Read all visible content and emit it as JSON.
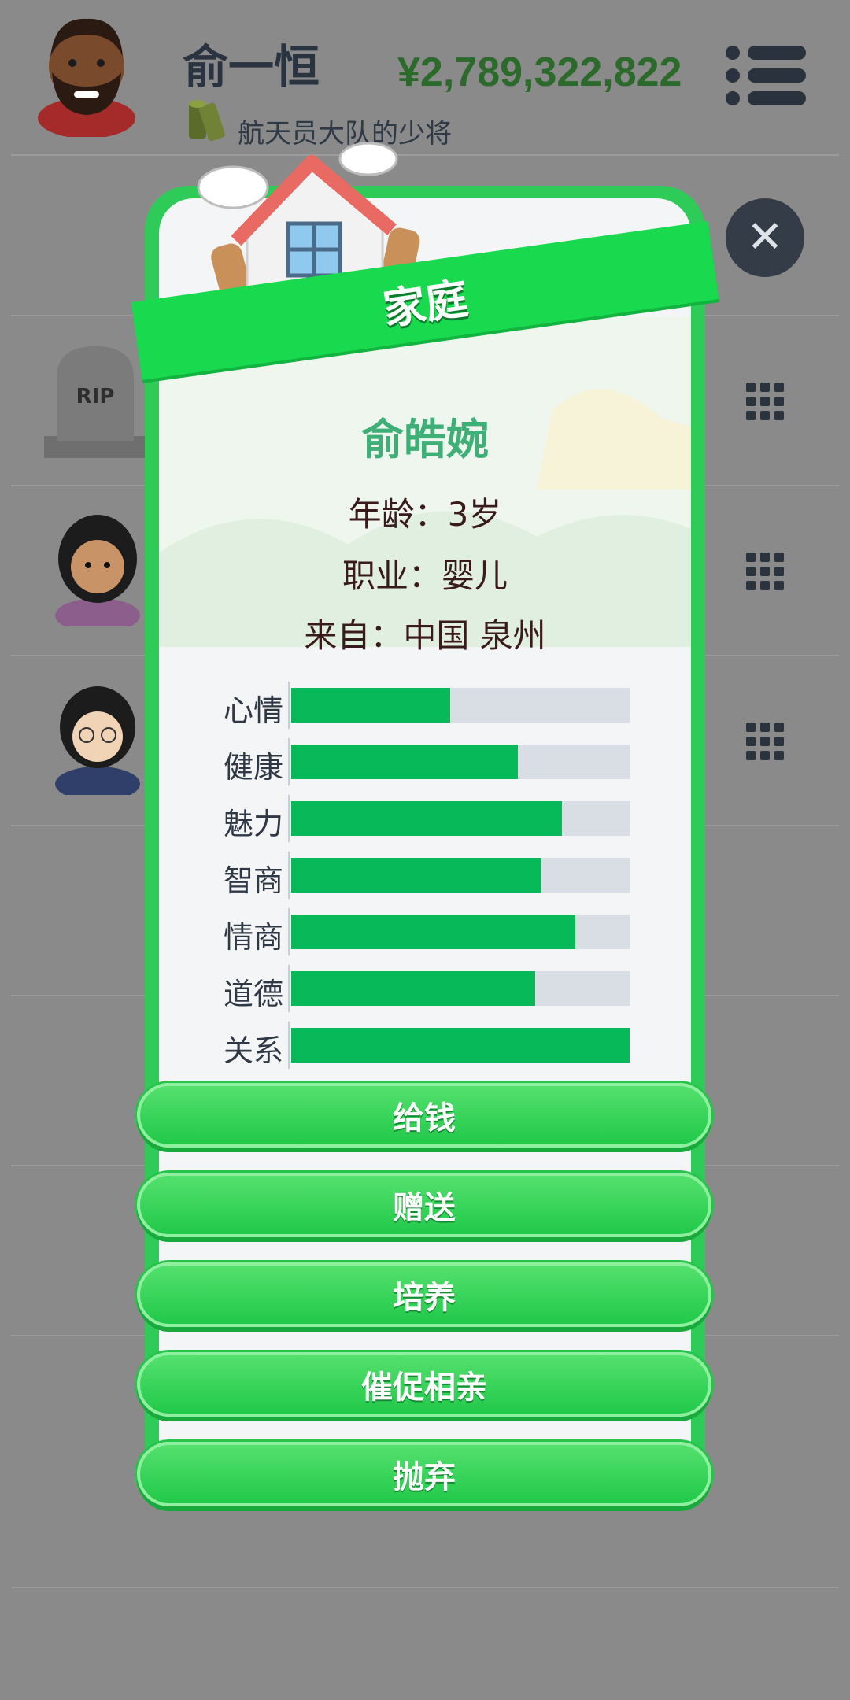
{
  "player": {
    "name": "俞一恒",
    "money": "¥2,789,322,822",
    "rank": "航天员大队的少将"
  },
  "modal": {
    "title": "家庭",
    "child": {
      "name": "俞皓婉",
      "age_line": "年龄：3岁",
      "job_line": "职业：婴儿",
      "origin_line": "来自：中国 泉州"
    },
    "stats": [
      {
        "label": "心情",
        "value": 0.47
      },
      {
        "label": "健康",
        "value": 0.67
      },
      {
        "label": "魅力",
        "value": 0.8
      },
      {
        "label": "智商",
        "value": 0.74
      },
      {
        "label": "情商",
        "value": 0.84
      },
      {
        "label": "道德",
        "value": 0.72
      },
      {
        "label": "关系",
        "value": 1.0
      }
    ],
    "actions": [
      "给钱",
      "赠送",
      "培养",
      "催促相亲",
      "抛弃"
    ]
  },
  "background": {
    "rip_text": "RIP"
  },
  "colors": {
    "accent": "#19d94f",
    "stat_fill": "#08b95a",
    "name_color": "#3daf77",
    "money_color": "#2c6a2c"
  }
}
